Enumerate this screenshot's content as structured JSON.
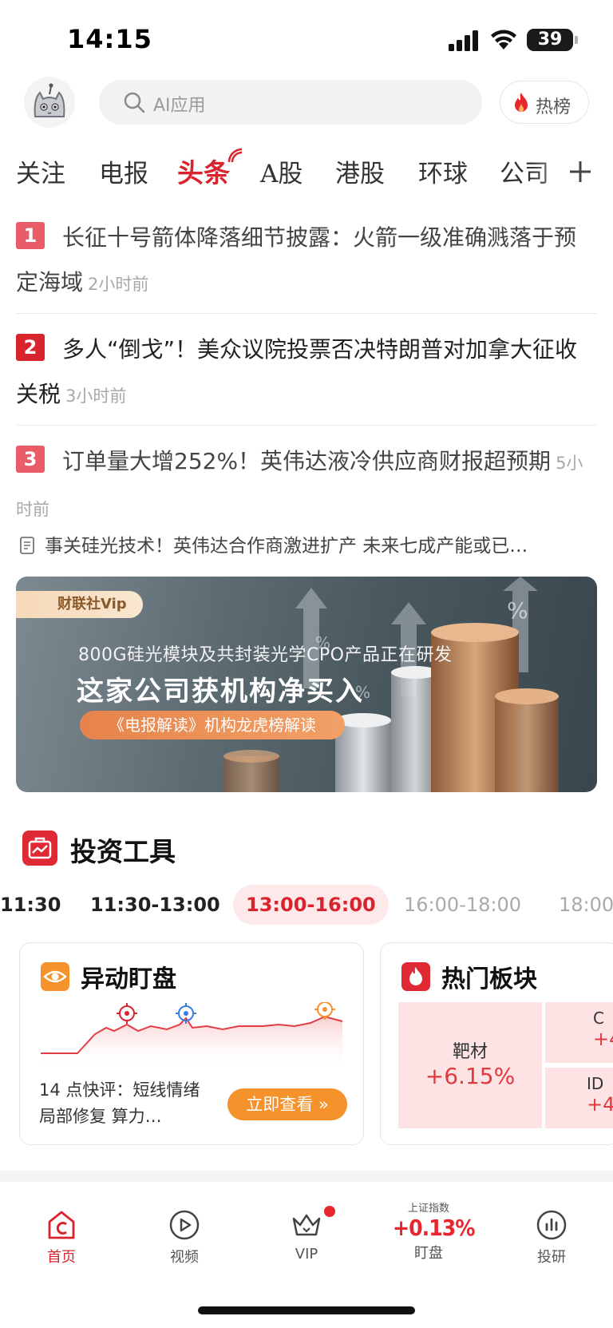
{
  "status_bar": {
    "time": "14:15",
    "battery": "39"
  },
  "header": {
    "search_placeholder": "AI应用",
    "hot_label": "热榜"
  },
  "tabs": [
    "关注",
    "电报",
    "头条",
    "A股",
    "港股",
    "环球",
    "公司"
  ],
  "headlines": [
    {
      "rank": "1",
      "title": "长征十号箭体降落细节披露：火箭一级准确溅落于预定海域",
      "ago": "2小时前"
    },
    {
      "rank": "2",
      "title": "多人“倒戈”！美众议院投票否决特朗普对加拿大征收关税",
      "ago": "3小时前"
    },
    {
      "rank": "3",
      "title": "订单量大增252%！英伟达液冷供应商财报超预期",
      "ago": "5小时前"
    }
  ],
  "sub_news": "事关硅光技术！英伟达合作商激进扩产 未来七成产能或已…",
  "banner": {
    "tag": "财联社Vip",
    "subtitle": "800G硅光模块及共封装光学CPO产品正在研发",
    "headline": "这家公司获机构净买入",
    "cta": "《电报解读》机构龙虎榜解读"
  },
  "tools": {
    "title": "投资工具",
    "time_slots": [
      "11:30",
      "11:30-13:00",
      "13:00-16:00",
      "16:00-18:00",
      "18:00"
    ],
    "watch_card": {
      "title": "异动盯盘",
      "comment": "14 点快评：短线情绪局部修复 算力…",
      "button": "立即查看 »"
    },
    "sector_card": {
      "title": "热门板块",
      "sectors": [
        {
          "name": "靶材",
          "change": "+6.15%"
        },
        {
          "name": "C",
          "change": "+4"
        },
        {
          "name": "ID",
          "change": "+4"
        }
      ]
    }
  },
  "bottom_nav": {
    "home": "首页",
    "video": "视频",
    "vip": "VIP",
    "index_name": "上证指数",
    "index_value": "+0.13%",
    "watch": "盯盘",
    "research": "投研"
  },
  "colors": {
    "brand_red": "#d8242c",
    "orange": "#f5922c",
    "rank_1": "#e85d67",
    "rank_2": "#d8242c",
    "rank_3": "#e85d67"
  }
}
